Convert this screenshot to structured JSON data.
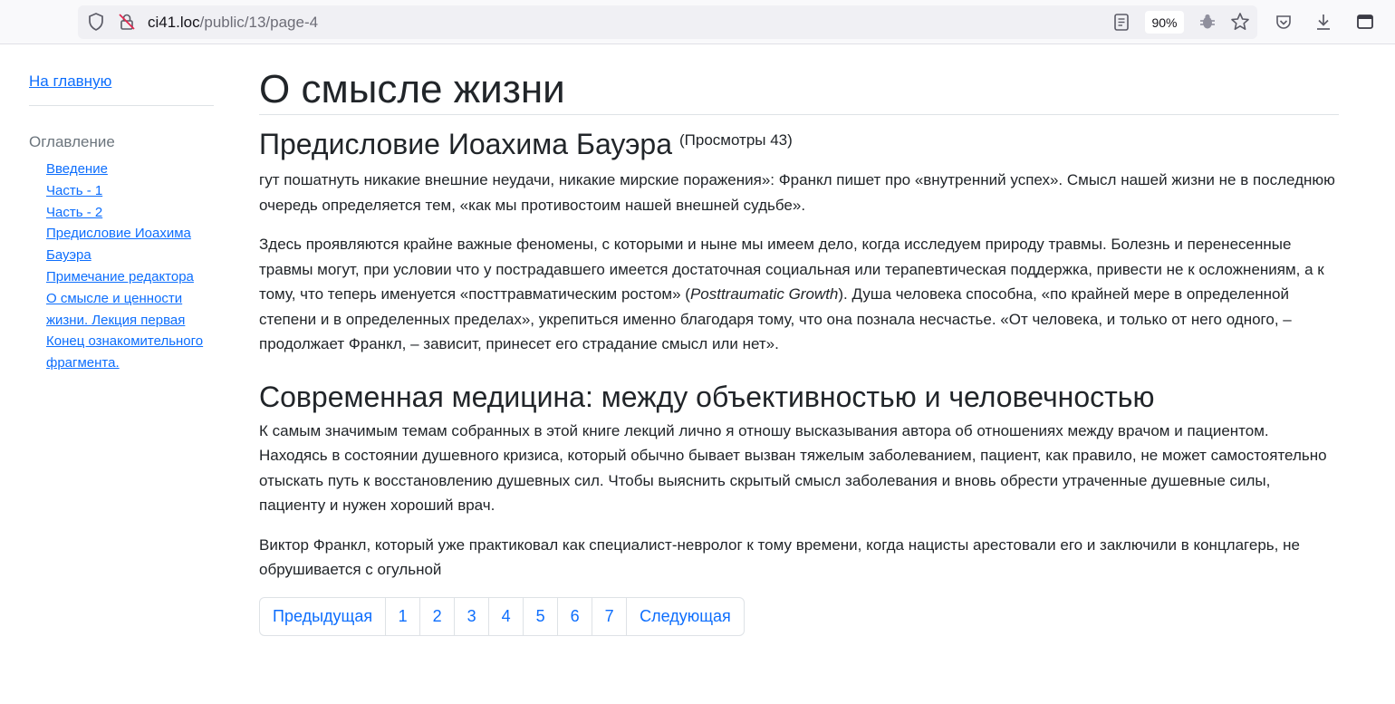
{
  "browser": {
    "url_host": "ci41.loc",
    "url_path": "/public/13/page-4",
    "zoom": "90%"
  },
  "sidebar": {
    "home_link": "На главную",
    "toc_title": "Оглавление",
    "toc_items": [
      "Введение",
      "Часть - 1",
      "Часть - 2",
      "Предисловие Иоахима Бауэра",
      "Примечание редактора",
      "О смысле и ценности жизни. Лекция первая",
      "Конец ознакомительного фрагмента."
    ]
  },
  "main": {
    "title": "О смысле жизни",
    "section_title": "Предисловие Иоахима Бауэра",
    "views": "(Просмотры 43)",
    "paragraphs": [
      "гут пошатнуть никакие внешние неудачи, никакие мирские поражения»: Франкл пишет про «внутренний успех». Смысл нашей жизни не в последнюю очередь определяется тем, «как мы противостоим нашей внешней судьбе».",
      "Здесь проявляются крайне важные феномены, с которыми и ныне мы имеем дело, когда исследуем природу травмы. Болезнь и перенесенные травмы могут, при условии что у пострадавшего имеется достаточная социальная или терапевтическая поддержка, привести не к осложнениям, а к тому, что теперь именуется «посттравматическим ростом» (",
      "Posttraumatic Growth",
      "). Душа человека способна, «по крайней мере в определенной степени и в определенных пределах», укрепиться именно благодаря тому, что она познала несчастье. «От человека, и только от него одного, – продолжает Франкл, – зависит, принесет его страдание смысл или нет»."
    ],
    "subsection_title": "Современная медицина: между объективностью и человечностью",
    "sub_paragraphs": [
      "К самым значимым темам собранных в этой книге лекций лично я отношу высказывания автора об отношениях между врачом и пациентом. Находясь в состоянии душевного кризиса, который обычно бывает вызван тяжелым заболеванием, пациент, как правило, не может самостоятельно отыскать путь к восстановлению душевных сил. Чтобы выяснить скрытый смысл заболевания и вновь обрести утраченные душевные силы, пациенту и нужен хороший врач.",
      "Виктор Франкл, который уже практиковал как специалист-невролог к тому времени, когда нацисты арестовали его и заключили в концлагерь, не обрушивается с огульной"
    ]
  },
  "pagination": {
    "prev": "Предыдущая",
    "pages": [
      "1",
      "2",
      "3",
      "4",
      "5",
      "6",
      "7"
    ],
    "next": "Следующая"
  }
}
